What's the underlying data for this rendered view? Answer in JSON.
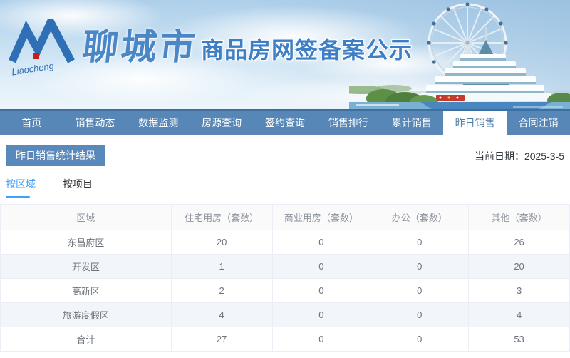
{
  "brand": {
    "logo_text": "Liaocheng",
    "city_name": "聊城市",
    "site_title": "商品房网签备案公示"
  },
  "nav": {
    "items": [
      {
        "label": "首页"
      },
      {
        "label": "销售动态"
      },
      {
        "label": "数据监测"
      },
      {
        "label": "房源查询"
      },
      {
        "label": "签约查询"
      },
      {
        "label": "销售排行"
      },
      {
        "label": "累计销售"
      },
      {
        "label": "昨日销售"
      },
      {
        "label": "合同注销"
      }
    ],
    "active_index": 7
  },
  "page": {
    "section_title": "昨日销售统计结果",
    "current_date": "当前日期：2025-3-5",
    "tabs": [
      {
        "label": "按区域"
      },
      {
        "label": "按项目"
      }
    ],
    "active_tab": "按区域"
  },
  "table": {
    "columns": [
      "区域",
      "住宅用房（套数）",
      "商业用房（套数）",
      "办公（套数）",
      "其他（套数）"
    ],
    "rows": [
      [
        "东昌府区",
        "20",
        "0",
        "0",
        "26"
      ],
      [
        "开发区",
        "1",
        "0",
        "0",
        "20"
      ],
      [
        "高新区",
        "2",
        "0",
        "0",
        "3"
      ],
      [
        "旅游度假区",
        "4",
        "0",
        "0",
        "4"
      ],
      [
        "合计",
        "27",
        "0",
        "0",
        "53"
      ]
    ]
  },
  "colors": {
    "nav_blue": "#5787b6",
    "badge_blue": "#5889ba",
    "tab_active_blue": "#409eff",
    "title_blue": "#3d7ec5",
    "stripe_row": "#f2f6fb",
    "table_border": "#ebeef5"
  }
}
